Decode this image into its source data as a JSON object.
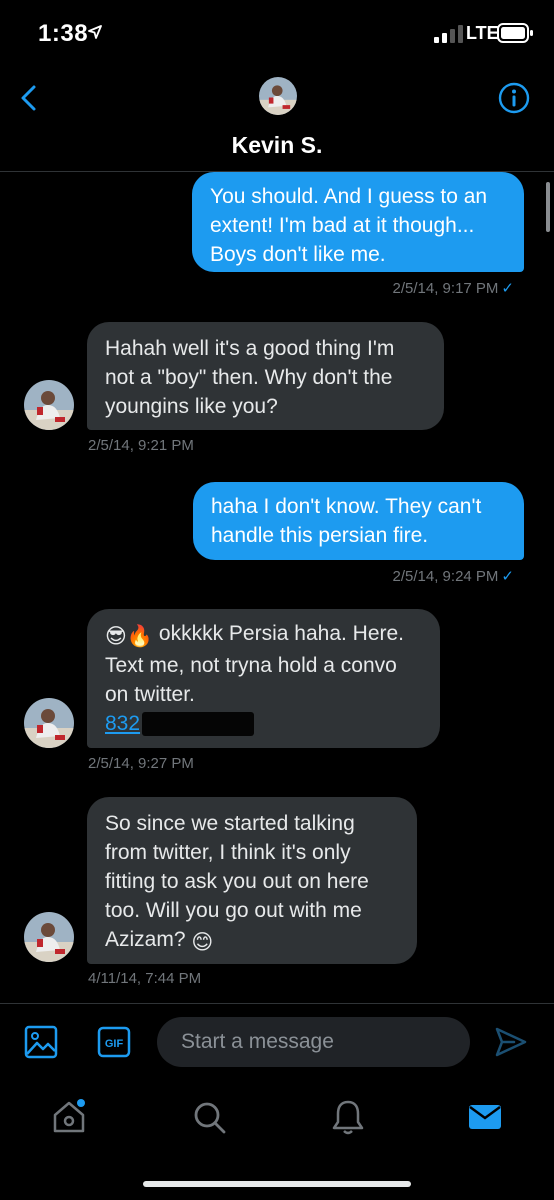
{
  "status_bar": {
    "time": "1:38",
    "network": "LTE"
  },
  "header": {
    "contact_name": "Kevin S."
  },
  "messages": [
    {
      "direction": "sent",
      "text": "You should. And I guess to an extent! I'm bad at it though... Boys don't like me.",
      "timestamp": "2/5/14, 9:17 PM",
      "read_mark": "✓"
    },
    {
      "direction": "received",
      "text": "Hahah well it's a good thing I'm not a \"boy\" then. Why don't the youngins like you?",
      "timestamp": "2/5/14, 9:21 PM"
    },
    {
      "direction": "sent",
      "text": "haha I don't know. They can't handle this persian fire.",
      "timestamp": "2/5/14, 9:24 PM",
      "read_mark": "✓"
    },
    {
      "direction": "received",
      "text": "okkkkk Persia haha. Here. Text me, not tryna hold a convo on twitter.",
      "link_prefix": "832",
      "emojis": [
        "😎",
        "🔥"
      ],
      "timestamp": "2/5/14, 9:27 PM"
    },
    {
      "direction": "received",
      "text": "So since we started talking from twitter, I think it's only fitting to ask you out on here too. Will you go out with me Azizam?",
      "emoji": "😊",
      "timestamp": "4/11/14, 7:44 PM"
    }
  ],
  "composer": {
    "placeholder": "Start a message",
    "gif_label": "GIF"
  },
  "colors": {
    "accent": "#1d9bf0",
    "received_bubble": "#2f3336",
    "background": "#000000"
  }
}
